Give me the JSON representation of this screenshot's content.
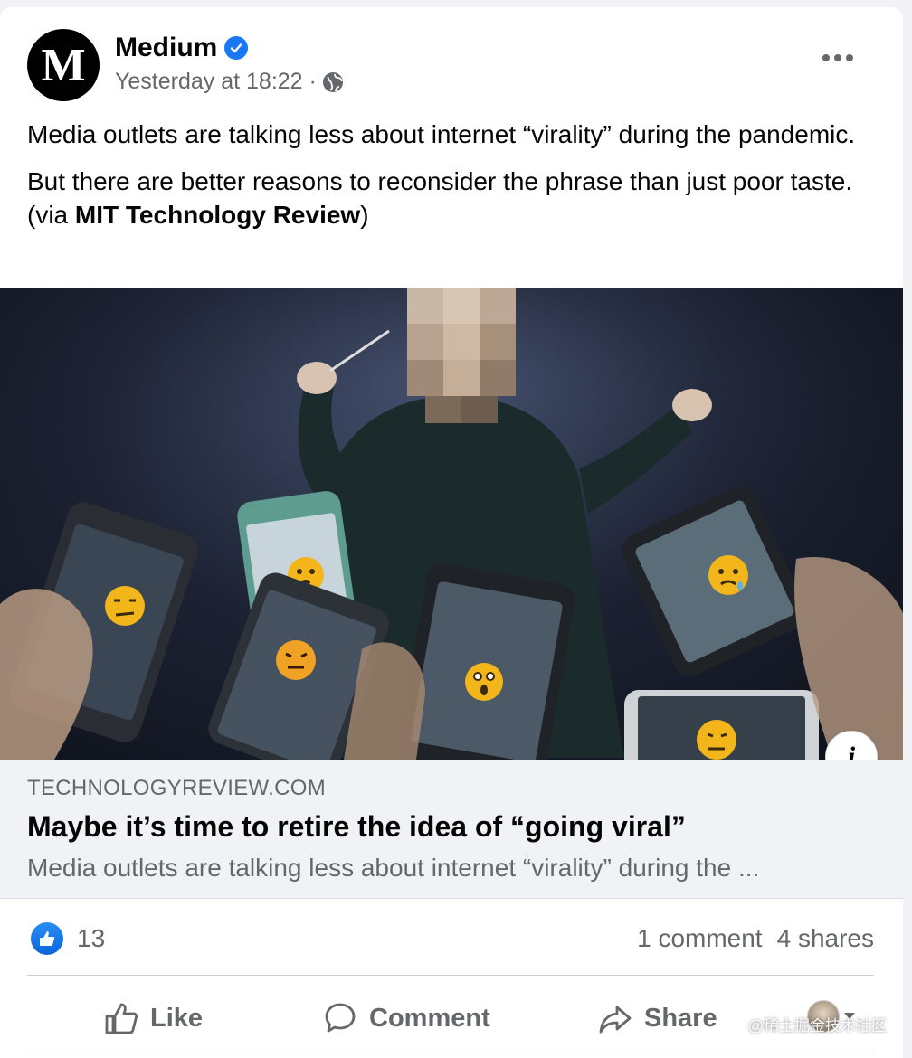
{
  "post": {
    "page_name": "Medium",
    "avatar_letter": "M",
    "timestamp": "Yesterday at 18:22 ·",
    "audience_icon": "globe-icon",
    "verified_icon": "verified-badge-icon",
    "paragraph1": "Media outlets are talking less about internet “virality” during the pandemic.",
    "paragraph2_prefix": "But there are better reasons to reconsider the phrase than just poor taste. (via ",
    "paragraph2_link": "MIT Technology Review",
    "paragraph2_suffix": ")"
  },
  "link_preview": {
    "domain": "TECHNOLOGYREVIEW.COM",
    "title": "Maybe it’s time to retire the idea of “going viral”",
    "description": "Media outlets are talking less about internet “virality” during the ...",
    "info_label": "i"
  },
  "stats": {
    "reaction_count": "13",
    "comments": "1 comment",
    "shares": "4 shares"
  },
  "actions": {
    "like": "Like",
    "comment": "Comment",
    "share": "Share"
  },
  "watermark": "@稀土掘金技术社区",
  "colors": {
    "brand_blue": "#1877f2",
    "secondary_text": "#65676b",
    "background": "#f0f2f5"
  }
}
